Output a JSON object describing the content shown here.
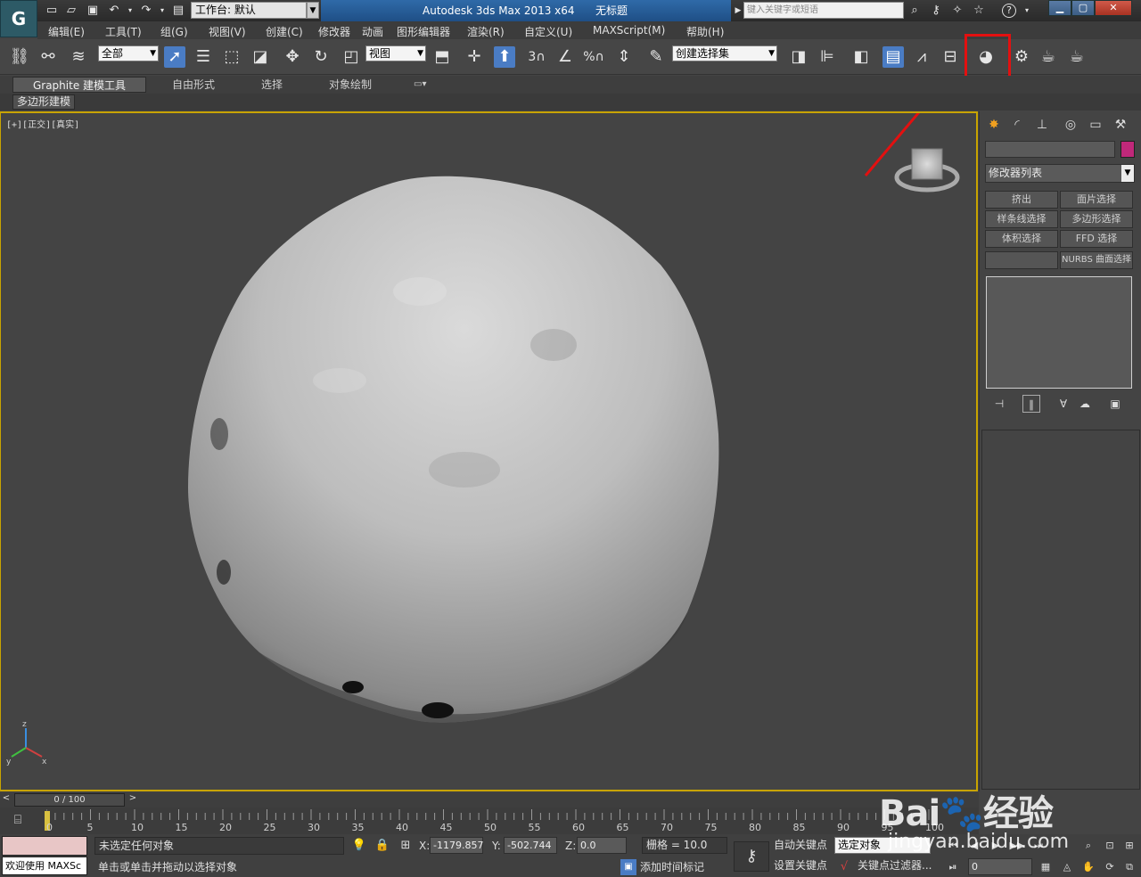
{
  "titlebar": {
    "workspace_label": "工作台: 默认",
    "app_title": "Autodesk 3ds Max  2013 x64",
    "doc_title": "无标题",
    "search_placeholder": "键入关键字或短语",
    "help_label": "?"
  },
  "menu": {
    "items": [
      "编辑(E)",
      "工具(T)",
      "组(G)",
      "视图(V)",
      "创建(C)",
      "修改器",
      "动画",
      "图形编辑器",
      "渲染(R)",
      "自定义(U)",
      "MAXScript(M)",
      "帮助(H)"
    ]
  },
  "toolbar": {
    "selection_filter": "全部",
    "ref_coord": "视图",
    "named_selection": "创建选择集",
    "snap_3": "3",
    "snap_percent": "%"
  },
  "ribbon": {
    "tabs": [
      "Graphite 建模工具",
      "自由形式",
      "选择",
      "对象绘制"
    ],
    "sub_label": "多边形建模"
  },
  "viewport": {
    "label": "[+][正交][真实]",
    "axis_x": "x",
    "axis_y": "y",
    "axis_z": "z"
  },
  "command_panel": {
    "modifier_list": "修改器列表",
    "modifier_buttons": [
      "挤出",
      "面片选择",
      "样条线选择",
      "多边形选择",
      "体积选择",
      "FFD 选择",
      "",
      "NURBS 曲面选择"
    ]
  },
  "timeline": {
    "frame_display": "0 / 100",
    "tick_labels": [
      "0",
      "5",
      "10",
      "15",
      "20",
      "25",
      "30",
      "35",
      "40",
      "45",
      "50",
      "55",
      "60",
      "65",
      "70",
      "75",
      "80",
      "85",
      "90",
      "95",
      "100"
    ]
  },
  "status": {
    "welcome": "欢迎使用 MAXSc",
    "selection": "未选定任何对象",
    "prompt": "单击或单击并拖动以选择对象",
    "x_label": "X:",
    "x_value": "-1179.857",
    "y_label": "Y:",
    "y_value": "-502.744",
    "z_label": "Z:",
    "z_value": "0.0",
    "grid": "栅格 = 10.0",
    "add_time_tag": "添加时间标记",
    "auto_key": "自动关键点",
    "set_key": "设置关键点",
    "selected_set": "选定对象",
    "key_filters": "关键点过滤器...",
    "current_frame": "0"
  },
  "watermark": {
    "brand": "Bai",
    "brand_cn": "经验",
    "url": "jingyan.baidu.com"
  },
  "colors": {
    "highlight": "#e31010",
    "viewport_border": "#c8a400",
    "object_color": "#c0287a",
    "active_tool": "#4a7cc4"
  }
}
